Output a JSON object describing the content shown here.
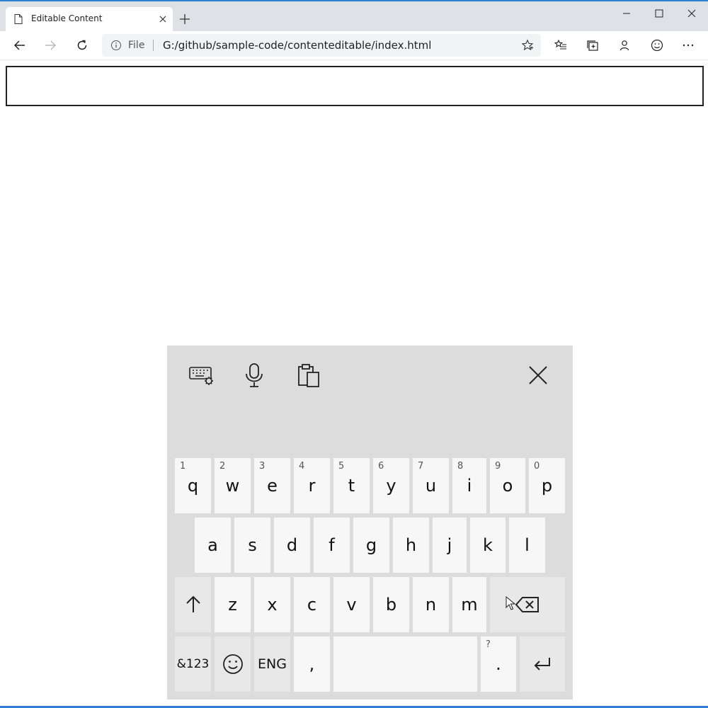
{
  "browser": {
    "tab": {
      "title": "Editable Content"
    },
    "address": {
      "scheme": "File",
      "url": "G:/github/sample-code/contenteditable/index.html"
    }
  },
  "page": {
    "editable_value": ""
  },
  "keyboard": {
    "rows": [
      [
        {
          "label": "q",
          "hint": "1"
        },
        {
          "label": "w",
          "hint": "2"
        },
        {
          "label": "e",
          "hint": "3"
        },
        {
          "label": "r",
          "hint": "4"
        },
        {
          "label": "t",
          "hint": "5"
        },
        {
          "label": "y",
          "hint": "6"
        },
        {
          "label": "u",
          "hint": "7"
        },
        {
          "label": "i",
          "hint": "8"
        },
        {
          "label": "o",
          "hint": "9"
        },
        {
          "label": "p",
          "hint": "0"
        }
      ],
      [
        {
          "label": "a"
        },
        {
          "label": "s"
        },
        {
          "label": "d"
        },
        {
          "label": "f"
        },
        {
          "label": "g"
        },
        {
          "label": "h"
        },
        {
          "label": "j"
        },
        {
          "label": "k"
        },
        {
          "label": "l"
        }
      ],
      [
        {
          "label": "z"
        },
        {
          "label": "x"
        },
        {
          "label": "c"
        },
        {
          "label": "v"
        },
        {
          "label": "b"
        },
        {
          "label": "n"
        },
        {
          "label": "m"
        }
      ]
    ],
    "symbols_key": "&123",
    "language_key": "ENG",
    "comma_key": ",",
    "period_key": ".",
    "period_hint": "?",
    "icons": {
      "settings": "keyboard-settings-icon",
      "mic": "microphone-icon",
      "clipboard": "clipboard-icon",
      "close": "close-icon",
      "shift": "shift-arrow-icon",
      "backspace": "backspace-icon",
      "emoji": "emoji-icon",
      "enter": "enter-icon"
    }
  },
  "colors": {
    "accent": "#2f7fd6",
    "keyboard_bg": "#dcdcdc",
    "key_bg": "#f7f7f7"
  }
}
